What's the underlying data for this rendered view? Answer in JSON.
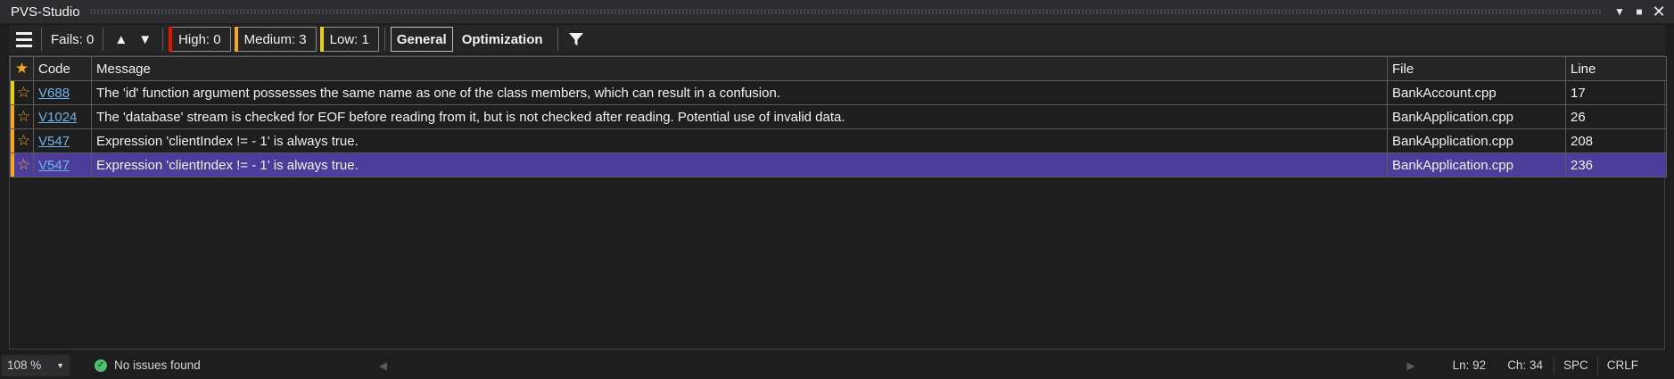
{
  "window": {
    "title": "PVS-Studio"
  },
  "toolbar": {
    "fails": "Fails: 0",
    "high": "High: 0",
    "medium": "Medium: 3",
    "low": "Low: 1",
    "tab_general": "General",
    "tab_optimization": "Optimization",
    "colors": {
      "high": "#e51400",
      "medium": "#f5a623",
      "low": "#e8d210"
    }
  },
  "table": {
    "headers": {
      "code": "Code",
      "message": "Message",
      "file": "File",
      "line": "Line"
    },
    "rows": [
      {
        "code": "V688",
        "message": "The 'id' function argument possesses the same name as one of the class members, which can result in a confusion.",
        "file": "BankAccount.cpp",
        "line": "17"
      },
      {
        "code": "V1024",
        "message": "The 'database' stream is checked for EOF before reading from it, but is not checked after reading. Potential use of invalid data.",
        "file": "BankApplication.cpp",
        "line": "26"
      },
      {
        "code": "V547",
        "message": "Expression 'clientIndex != - 1' is always true.",
        "file": "BankApplication.cpp",
        "line": "208"
      },
      {
        "code": "V547",
        "message": "Expression 'clientIndex != - 1' is always true.",
        "file": "BankApplication.cpp",
        "line": "236"
      }
    ],
    "selected_color": "#4c3d9b"
  },
  "statusbar": {
    "zoom": "108 %",
    "status": "No issues found",
    "ln": "Ln: 92",
    "ch": "Ch: 34",
    "spc": "SPC",
    "eol": "CRLF"
  }
}
